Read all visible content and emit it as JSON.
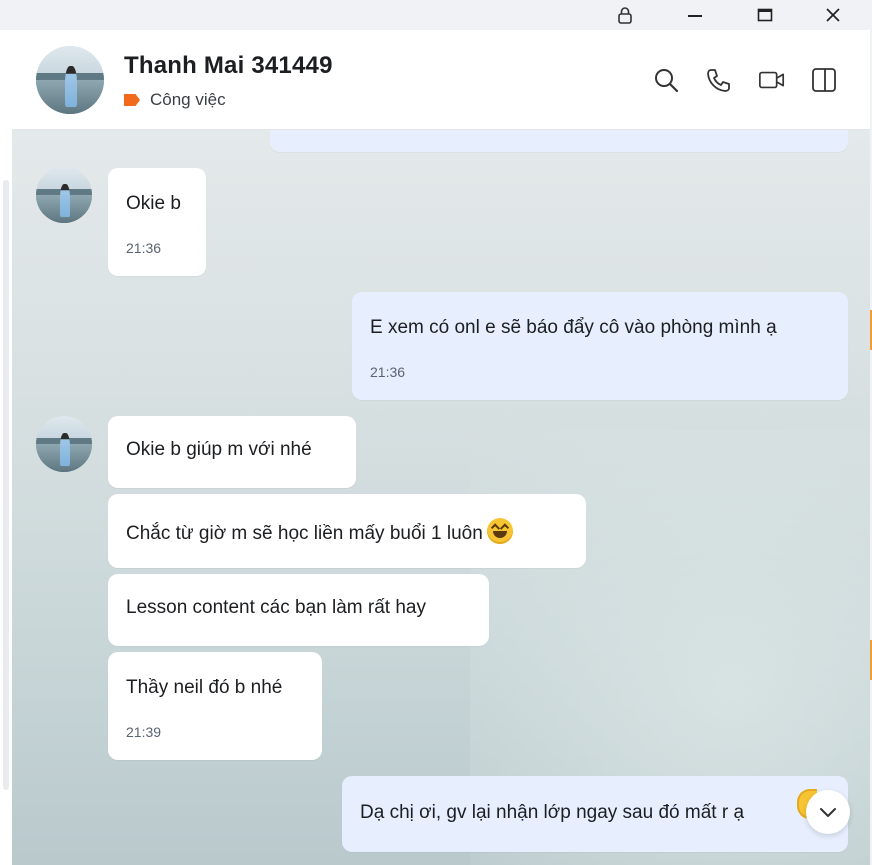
{
  "window": {
    "controls": [
      "lock",
      "minimize",
      "maximize",
      "close"
    ]
  },
  "header": {
    "contact_name": "Thanh Mai 341449",
    "tag_label": "Công việc",
    "tag_color": "#f26b1d",
    "actions": [
      "search-icon",
      "phone-icon",
      "video-call-icon",
      "side-panel-icon"
    ]
  },
  "messages": [
    {
      "from": "them",
      "text": "Okie b",
      "time": "21:36"
    },
    {
      "from": "me",
      "text": "E xem có onl e sẽ báo đẩy cô vào phòng mình ạ",
      "time": "21:36"
    },
    {
      "from": "them",
      "text": "Okie b giúp m với nhé"
    },
    {
      "from": "them",
      "text": "Chắc từ giờ m sẽ học liền mấy buổi 1 luôn",
      "emoji": "laughing-face"
    },
    {
      "from": "them",
      "text": "Lesson content các bạn làm rất hay"
    },
    {
      "from": "them",
      "text": "Thầy neil đó b nhé",
      "time": "21:39"
    },
    {
      "from": "me",
      "text": "Dạ chị ơi, gv lại nhận lớp ngay sau đó mất r ạ"
    }
  ],
  "colors": {
    "my_bubble": "#e7efff",
    "their_bubble": "#ffffff",
    "tag": "#f26b1d"
  }
}
